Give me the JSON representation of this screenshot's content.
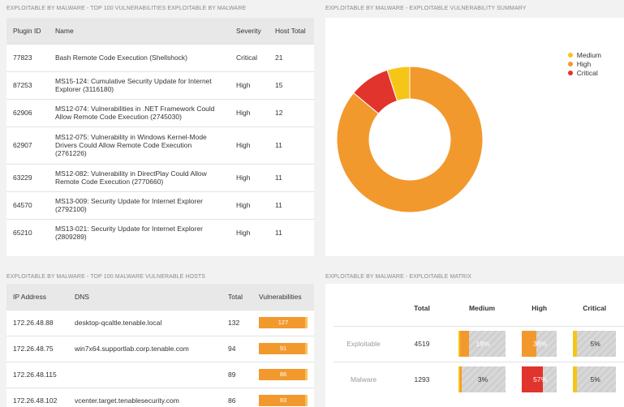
{
  "panels": {
    "vulns_title": "EXPLOITABLE BY MALWARE - TOP 100 VULNERABILITIES EXPLOITABLE BY MALWARE",
    "summary_title": "EXPLOITABLE BY MALWARE - EXPLOITABLE VULNERABILITY SUMMARY",
    "hosts_title": "EXPLOITABLE BY MALWARE - TOP 100 MALWARE VULNERABLE HOSTS",
    "matrix_title": "EXPLOITABLE BY MALWARE - EXPLOITABLE MATRIX"
  },
  "vulns": {
    "headers": [
      "Plugin ID",
      "Name",
      "Severity",
      "Host Total"
    ],
    "rows": [
      {
        "id": "77823",
        "name": "Bash Remote Code Execution (Shellshock)",
        "severity": "Critical",
        "total": "21"
      },
      {
        "id": "87253",
        "name": "MS15-124: Cumulative Security Update for Internet Explorer (3116180)",
        "severity": "High",
        "total": "15"
      },
      {
        "id": "62906",
        "name": "MS12-074: Vulnerabilities in .NET Framework Could Allow Remote Code Execution (2745030)",
        "severity": "High",
        "total": "12"
      },
      {
        "id": "62907",
        "name": "MS12-075: Vulnerability in Windows Kernel-Mode Drivers Could Allow Remote Code Execution (2761226)",
        "severity": "High",
        "total": "11"
      },
      {
        "id": "63229",
        "name": "MS12-082: Vulnerability in DirectPlay Could Allow Remote Code Execution (2770660)",
        "severity": "High",
        "total": "11"
      },
      {
        "id": "64570",
        "name": "MS13-009: Security Update for Internet Explorer (2792100)",
        "severity": "High",
        "total": "11"
      },
      {
        "id": "65210",
        "name": "MS13-021: Security Update for Internet Explorer (2809289)",
        "severity": "High",
        "total": "11"
      }
    ]
  },
  "chart_data": {
    "type": "pie",
    "categories": [
      "Medium",
      "High",
      "Critical"
    ],
    "values": [
      5,
      86,
      9
    ],
    "colors": [
      "#f5c518",
      "#f2992e",
      "#e0342c"
    ],
    "donut": true,
    "legend": "top-right"
  },
  "hosts": {
    "headers": [
      "IP Address",
      "DNS",
      "Total",
      "Vulnerabilities"
    ],
    "rows": [
      {
        "ip": "172.26.48.88",
        "dns": "desktop-qcaltle.tenable.local",
        "total": "132",
        "vulns": "127"
      },
      {
        "ip": "172.26.48.75",
        "dns": "win7x64.supportlab.corp.tenable.com",
        "total": "94",
        "vulns": "91"
      },
      {
        "ip": "172.26.48.115",
        "dns": "",
        "total": "89",
        "vulns": "86"
      },
      {
        "ip": "172.26.48.102",
        "dns": "vcenter.target.tenablesecurity.com",
        "total": "86",
        "vulns": "83"
      }
    ]
  },
  "matrix": {
    "headers": [
      "",
      "Total",
      "Medium",
      "High",
      "Critical"
    ],
    "rows": [
      {
        "label": "Exploitable",
        "total": "4519",
        "medium": {
          "text": "19%",
          "pct": 19
        },
        "high": {
          "text": "38%",
          "pct": 38
        },
        "critical": {
          "text": "5%",
          "pct": 5
        }
      },
      {
        "label": "Malware",
        "total": "1293",
        "medium": {
          "text": "3%",
          "pct": 3
        },
        "high": {
          "text": "57%",
          "pct": 57
        },
        "critical": {
          "text": "5%",
          "pct": 5
        }
      }
    ]
  }
}
